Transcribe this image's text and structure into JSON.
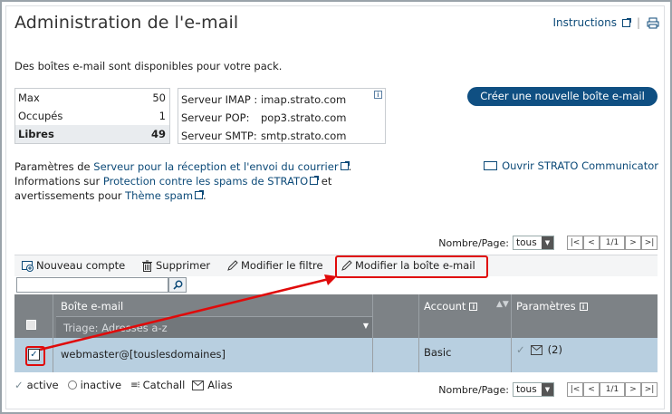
{
  "header": {
    "title": "Administration de l'e-mail",
    "instructions_link": "Instructions",
    "separator": "|"
  },
  "intro_text": "Des boîtes e-mail sont disponibles pour votre pack.",
  "stats": [
    {
      "label": "Max",
      "value": "50"
    },
    {
      "label": "Occupés",
      "value": "1"
    },
    {
      "label": "Libres",
      "value": "49"
    }
  ],
  "servers": [
    {
      "label": "Serveur IMAP :",
      "value": "imap.strato.com"
    },
    {
      "label": "Serveur POP:",
      "value": "pop3.strato.com"
    },
    {
      "label": "Serveur SMTP:",
      "value": "smtp.strato.com"
    }
  ],
  "info_glyph": "i",
  "create_button": "Créer une nouvelle boîte e-mail",
  "links": {
    "line1_prefix": "Paramètres de ",
    "line1_link": "Serveur pour la réception et l'envoi du courrier",
    "line1_suffix": ".",
    "line2_prefix": "Informations sur ",
    "line2_link": "Protection contre les spams de STRATO",
    "line2_suffix": " et",
    "line3_prefix": "avertissements pour ",
    "line3_link": "Thème spam",
    "line3_suffix": "."
  },
  "communicator_link": "Ouvrir STRATO Communicator",
  "pager": {
    "label": "Nombre/Page:",
    "select_value": "tous",
    "first": "|<",
    "prev": "<",
    "page": "1/1",
    "next": ">",
    "last": ">|"
  },
  "toolbar": {
    "new_account": "Nouveau compte",
    "delete": "Supprimer",
    "edit_filter": "Modifier le filtre",
    "edit_mailbox": "Modifier la boîte e-mail"
  },
  "search": {
    "value": "",
    "placeholder": ""
  },
  "table": {
    "col_mailbox": "Boîte e-mail",
    "sort_label": "Triage: Adresses a-z",
    "col_account": "Account",
    "col_settings": "Paramètres",
    "rows": [
      {
        "address": "webmaster@[touslesdomaines]",
        "account": "Basic",
        "alias_count": "(2)",
        "checked": true
      }
    ]
  },
  "legend": {
    "active": "active",
    "inactive": "inactive",
    "catchall": "Catchall",
    "alias": "Alias"
  },
  "colors": {
    "accent": "#0f4f82",
    "link": "#0c4a78",
    "table_header": "#7d8286",
    "selected_row": "#b8cfe0",
    "highlight": "#e00a0a"
  }
}
